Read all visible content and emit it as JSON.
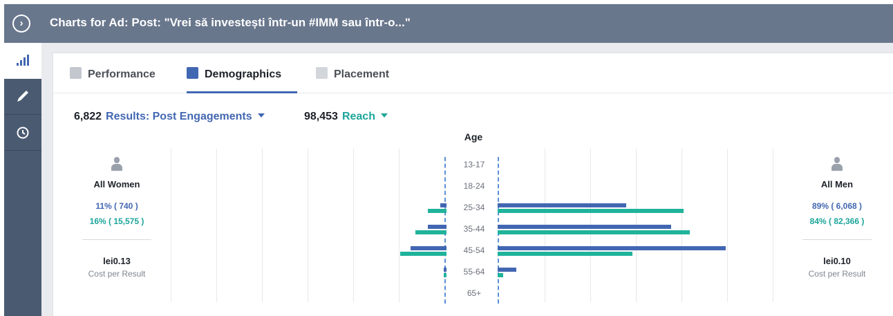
{
  "header": {
    "title": "Charts for Ad: Post: \"Vrei să investești într-un #IMM sau într-o...\"",
    "collapse_icon": "chevron-right-circle-icon"
  },
  "sidebar": {
    "items": [
      {
        "icon": "bar-chart-icon",
        "active": true
      },
      {
        "icon": "pencil-icon",
        "active": false
      },
      {
        "icon": "clock-icon",
        "active": false
      }
    ]
  },
  "tabs": [
    {
      "label": "Performance",
      "icon": "performance-icon",
      "active": false
    },
    {
      "label": "Demographics",
      "icon": "demographics-icon",
      "active": true
    },
    {
      "label": "Placement",
      "icon": "placement-icon",
      "active": false
    }
  ],
  "metrics": {
    "primary": {
      "value": "6,822",
      "label": "Results: Post Engagements"
    },
    "secondary": {
      "value": "98,453",
      "label": "Reach"
    }
  },
  "chart": {
    "title": "Age",
    "colors": {
      "results": "#4267b2",
      "reach": "#20b39b"
    }
  },
  "chart_data": {
    "type": "bar",
    "orientation": "horizontal-butterfly",
    "categories": [
      "13-17",
      "18-24",
      "25-34",
      "35-44",
      "45-54",
      "55-64",
      "65+"
    ],
    "women": {
      "results": [
        0,
        0,
        0.6,
        1.8,
        3.5,
        0.3,
        0
      ],
      "reach": [
        0,
        0,
        1.8,
        3.0,
        4.5,
        0.3,
        0
      ]
    },
    "men": {
      "results": [
        0,
        0,
        12.4,
        16.7,
        22.0,
        1.8,
        0
      ],
      "reach": [
        0,
        0,
        17.9,
        18.5,
        13.0,
        0.5,
        0
      ]
    }
  },
  "women": {
    "label": "All Women",
    "results_pct": "11% ( 740 )",
    "reach_pct": "16% ( 15,575 )",
    "cost": "lei0.13",
    "cost_label": "Cost per Result"
  },
  "men": {
    "label": "All Men",
    "results_pct": "89% ( 6,068 )",
    "reach_pct": "84% ( 82,366 )",
    "cost": "lei0.10",
    "cost_label": "Cost per Result"
  }
}
